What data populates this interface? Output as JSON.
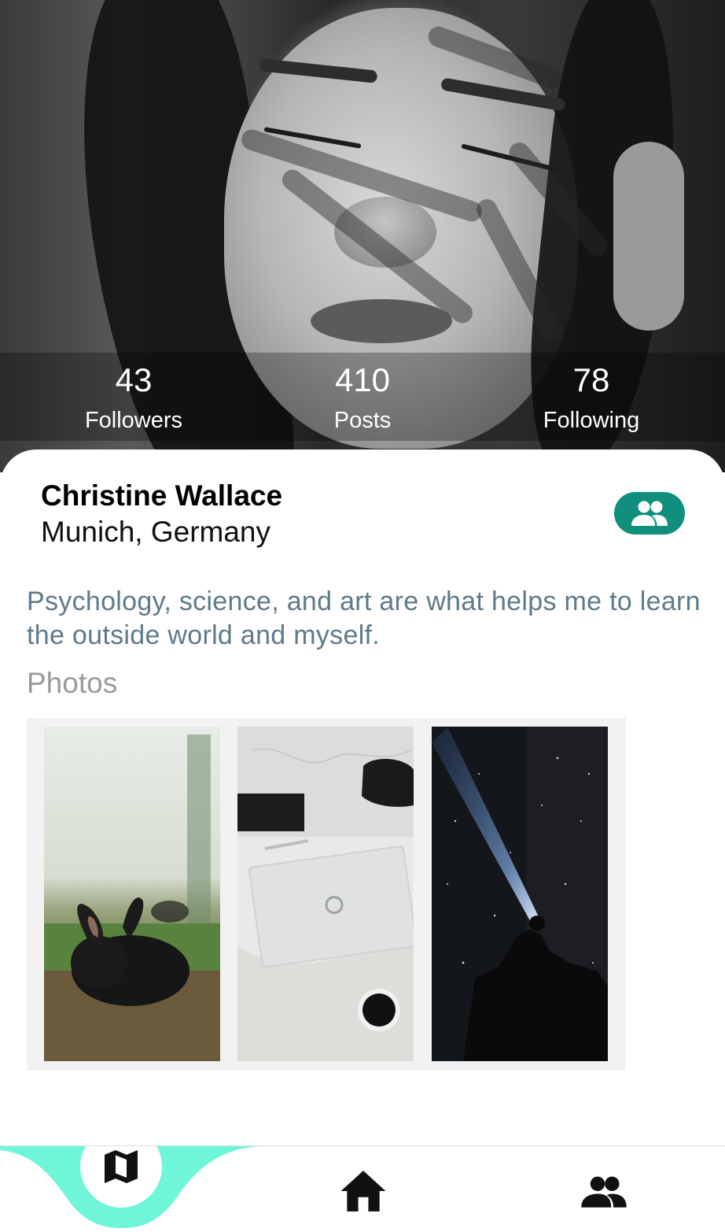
{
  "stats": [
    {
      "value": "43",
      "label": "Followers"
    },
    {
      "value": "410",
      "label": "Posts"
    },
    {
      "value": "78",
      "label": "Following"
    }
  ],
  "profile": {
    "name": "Christine Wallace",
    "location": "Munich, Germany",
    "bio": "Psychology, science, and art are what helps me to learn the outside world and myself.",
    "friends_icon": "group-icon"
  },
  "photos": {
    "label": "Photos",
    "items": [
      {
        "subject": "black rabbit"
      },
      {
        "subject": "laptop on desk"
      },
      {
        "subject": "night sky with flashlight"
      }
    ]
  },
  "nav": {
    "items": [
      {
        "icon": "map-icon",
        "active": true
      },
      {
        "icon": "home-icon",
        "active": false
      },
      {
        "icon": "people-icon",
        "active": false
      }
    ]
  },
  "colors": {
    "accent": "#0f8f7c",
    "nav_active": "#6ff5d8",
    "bio_text": "#5f7a89",
    "muted": "#9a9a9a"
  }
}
